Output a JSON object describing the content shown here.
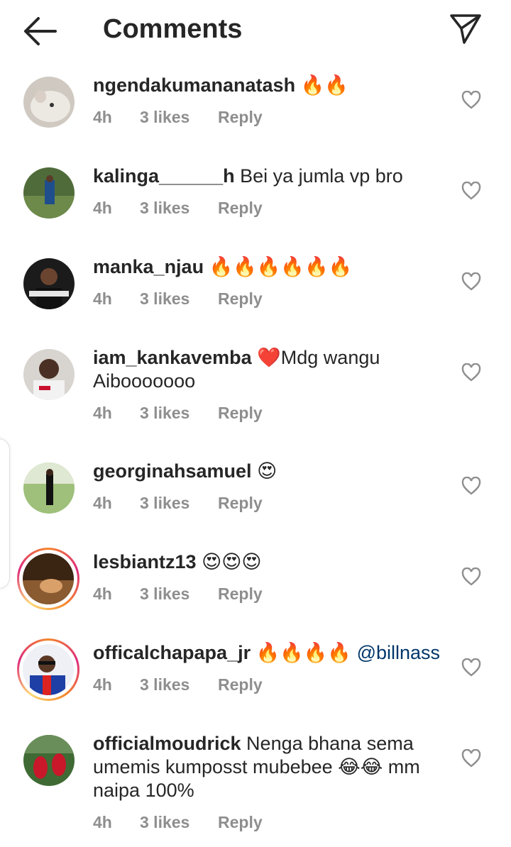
{
  "header": {
    "title": "Comments",
    "back_icon": "arrow-left-icon",
    "send_icon": "paper-plane-icon"
  },
  "comments": [
    {
      "username": "ngendakumananatash",
      "text": " 🔥🔥",
      "time": "4h",
      "likes": "3 likes",
      "reply": "Reply"
    },
    {
      "username": "kalinga______h",
      "text": " Bei ya jumla vp bro",
      "time": "4h",
      "likes": "3 likes",
      "reply": "Reply"
    },
    {
      "username": "manka_njau",
      "text": " 🔥🔥🔥🔥🔥🔥",
      "time": "4h",
      "likes": "3 likes",
      "reply": "Reply"
    },
    {
      "username": "iam_kankavemba",
      "text": " ❤️Mdg wangu Aibooooooo",
      "time": "4h",
      "likes": "3 likes",
      "reply": "Reply"
    },
    {
      "username": "georginahsamuel",
      "text": " 😍",
      "time": "4h",
      "likes": "3 likes",
      "reply": "Reply"
    },
    {
      "username": "lesbiantz13",
      "text": " 😍😍😍",
      "time": "4h",
      "likes": "3 likes",
      "reply": "Reply"
    },
    {
      "username": "officalchapapa_jr",
      "text": " 🔥🔥🔥🔥 ",
      "mention": "@billnass",
      "time": "4h",
      "likes": "3 likes",
      "reply": "Reply"
    },
    {
      "username": "officialmoudrick",
      "text": " Nenga bhana sema umemis kumposst mubebee 😂😂 mm naipa 100%",
      "time": "4h",
      "likes": "3 likes",
      "reply": "Reply"
    }
  ],
  "colors": {
    "meta": "#8e8e8e",
    "text": "#262626",
    "mention": "#00376b",
    "story_ring": "#dd2a7b"
  }
}
